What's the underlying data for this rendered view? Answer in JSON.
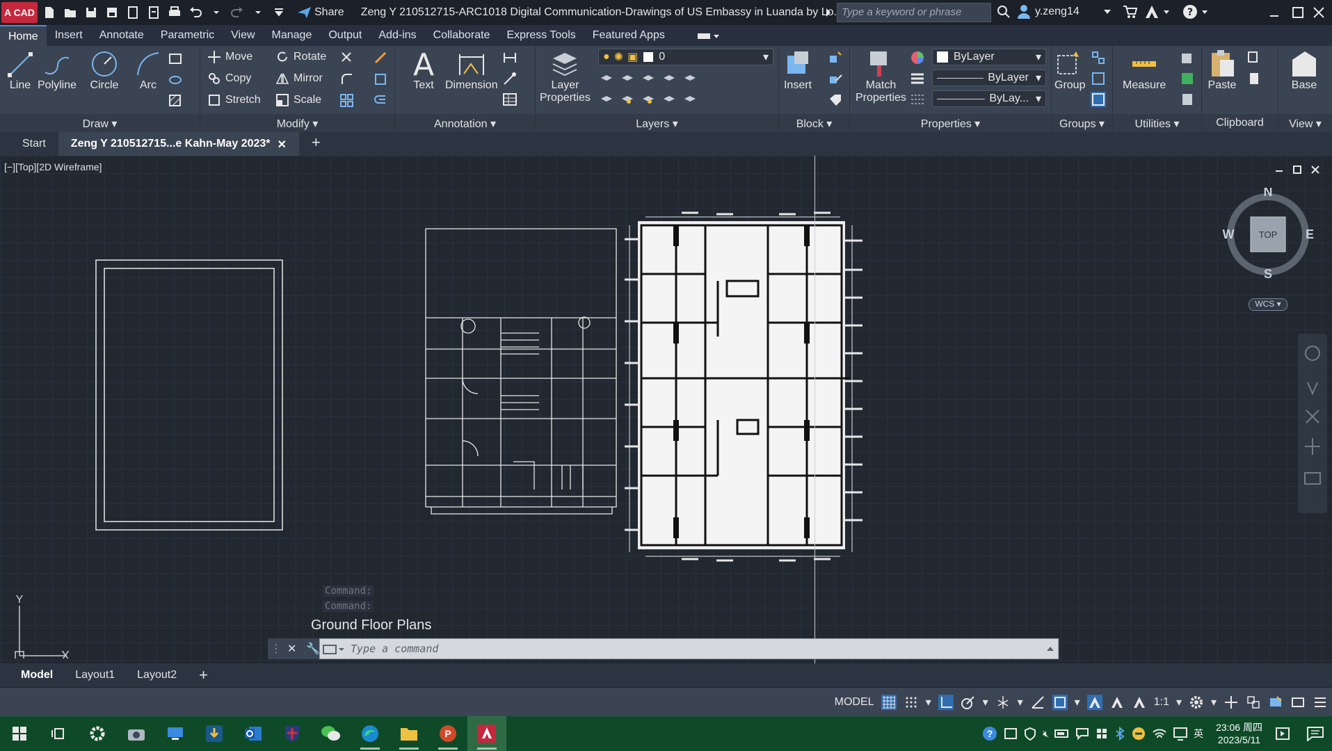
{
  "app": {
    "logo_text": "A CAD",
    "title": "Zeng Y 210512715-ARC1018 Digital Communication-Drawings of  US Embassy in Luanda by Lo...",
    "share_label": "Share"
  },
  "search": {
    "placeholder": "Type a keyword or phrase"
  },
  "user": {
    "name": "y.zeng14"
  },
  "ribbon_tabs": [
    "Home",
    "Insert",
    "Annotate",
    "Parametric",
    "View",
    "Manage",
    "Output",
    "Add-ins",
    "Collaborate",
    "Express Tools",
    "Featured Apps"
  ],
  "draw": {
    "title": "Draw",
    "line": "Line",
    "polyline": "Polyline",
    "circle": "Circle",
    "arc": "Arc"
  },
  "modify": {
    "title": "Modify",
    "move": "Move",
    "rotate": "Rotate",
    "copy": "Copy",
    "mirror": "Mirror",
    "stretch": "Stretch",
    "scale": "Scale"
  },
  "annotation": {
    "title": "Annotation",
    "text": "Text",
    "dimension": "Dimension"
  },
  "layers": {
    "title": "Layers",
    "layer_properties_1": "Layer",
    "layer_properties_2": "Properties",
    "current_layer": "0"
  },
  "block": {
    "title": "Block",
    "insert": "Insert"
  },
  "properties": {
    "title": "Properties",
    "match_1": "Match",
    "match_2": "Properties",
    "color": "ByLayer",
    "linetype": "ByLayer",
    "lineweight": "ByLay..."
  },
  "groups": {
    "title": "Groups",
    "group": "Group"
  },
  "utilities": {
    "title": "Utilities",
    "measure": "Measure"
  },
  "clipboard": {
    "title": "Clipboard",
    "paste": "Paste"
  },
  "view_panel": {
    "title": "View",
    "base": "Base"
  },
  "file_tabs": {
    "start": "Start",
    "active": "Zeng Y 210512715...e Kahn-May 2023*"
  },
  "viewport": {
    "label": "[−][Top][2D Wireframe]",
    "compass_n": "N",
    "compass_s": "S",
    "compass_e": "E",
    "compass_w": "W",
    "cube_face": "TOP",
    "wcs": "WCS",
    "ucs_x": "X",
    "ucs_y": "Y"
  },
  "command": {
    "history": [
      "Command:",
      "Command:"
    ],
    "tooltip": "Ground Floor Plans",
    "placeholder": "Type a command"
  },
  "layout_tabs": [
    "Model",
    "Layout1",
    "Layout2"
  ],
  "status": {
    "model": "MODEL",
    "scale": "1:1"
  },
  "tray": {
    "ime": "英",
    "time": "23:06 周四",
    "date": "2023/5/11"
  },
  "colors": {
    "accent": "#4a90d9",
    "viewport_bg": "#212830",
    "ribbon_bg": "#3b4453",
    "taskbar_bg": "#0f4a28",
    "logo_red": "#c5283d"
  }
}
